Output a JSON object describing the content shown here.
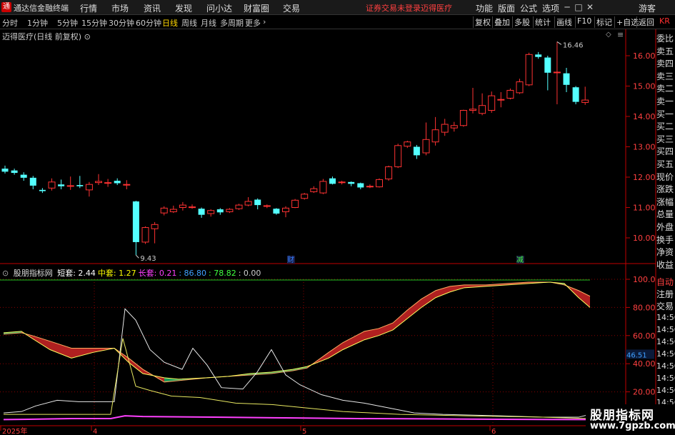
{
  "app": {
    "title": "通达信金融终端",
    "menu": [
      "行情",
      "市场",
      "资讯",
      "发现",
      "问小达",
      "财富圈",
      "交易"
    ],
    "notice": "证券交易未登录",
    "stock_name_notice": "迈得医疗",
    "right_menu": [
      "功能",
      "版面",
      "公式",
      "选项"
    ],
    "guest": "游客"
  },
  "toolbar": {
    "periods": [
      "分时",
      "1分钟",
      "5分钟",
      "15分钟",
      "30分钟",
      "60分钟",
      "日线",
      "周线",
      "月线",
      "多周期",
      "更多"
    ],
    "active_period": "日线",
    "buttons": [
      "复权",
      "叠加",
      "多股",
      "统计",
      "画线",
      "F10",
      "标记",
      "+自选",
      "返回"
    ]
  },
  "chart": {
    "header": "迈得医疗(日线 前复权)",
    "price_ticks": [
      "16.00",
      "15.00",
      "14.00",
      "13.00",
      "12.00",
      "11.00",
      "10.00"
    ],
    "annotations": {
      "high": "16.46",
      "low": "9.43",
      "mark1": "财",
      "mark2": "减"
    },
    "date_labels": [
      "2025年",
      "4",
      "5",
      "6"
    ],
    "candles": [
      {
        "o": 12.28,
        "c": 12.18,
        "h": 12.38,
        "l": 12.12
      },
      {
        "o": 12.22,
        "c": 12.14,
        "h": 12.28,
        "l": 12.08
      },
      {
        "o": 12.08,
        "c": 11.98,
        "h": 12.16,
        "l": 11.88
      },
      {
        "o": 11.98,
        "c": 11.72,
        "h": 12.04,
        "l": 11.6
      },
      {
        "o": 11.58,
        "c": 11.54,
        "h": 11.64,
        "l": 11.48
      },
      {
        "o": 11.64,
        "c": 11.84,
        "h": 11.96,
        "l": 11.56
      },
      {
        "o": 11.76,
        "c": 11.7,
        "h": 11.92,
        "l": 11.6
      },
      {
        "o": 11.72,
        "c": 11.72,
        "h": 12.02,
        "l": 11.58
      },
      {
        "o": 11.74,
        "c": 11.7,
        "h": 12.04,
        "l": 11.64
      },
      {
        "o": 11.58,
        "c": 11.76,
        "h": 11.84,
        "l": 11.36
      },
      {
        "o": 11.82,
        "c": 11.86,
        "h": 12.1,
        "l": 11.74
      },
      {
        "o": 11.8,
        "c": 11.82,
        "h": 11.94,
        "l": 11.68
      },
      {
        "o": 11.88,
        "c": 11.8,
        "h": 11.96,
        "l": 11.74
      },
      {
        "o": 11.74,
        "c": 11.76,
        "h": 11.9,
        "l": 11.6
      },
      {
        "o": 11.2,
        "c": 9.86,
        "h": 11.22,
        "l": 9.43
      },
      {
        "o": 9.86,
        "c": 10.34,
        "h": 10.38,
        "l": 9.8
      },
      {
        "o": 10.3,
        "c": 10.44,
        "h": 10.52,
        "l": 9.82
      },
      {
        "o": 10.82,
        "c": 10.98,
        "h": 11.04,
        "l": 10.74
      },
      {
        "o": 10.86,
        "c": 10.94,
        "h": 11.06,
        "l": 10.82
      },
      {
        "o": 11.0,
        "c": 11.08,
        "h": 11.18,
        "l": 10.9
      },
      {
        "o": 11.02,
        "c": 11.02,
        "h": 11.1,
        "l": 10.96
      },
      {
        "o": 10.96,
        "c": 10.76,
        "h": 11.0,
        "l": 10.66
      },
      {
        "o": 10.8,
        "c": 10.9,
        "h": 10.94,
        "l": 10.7
      },
      {
        "o": 10.94,
        "c": 10.84,
        "h": 10.98,
        "l": 10.76
      },
      {
        "o": 10.86,
        "c": 10.94,
        "h": 10.98,
        "l": 10.82
      },
      {
        "o": 10.96,
        "c": 11.08,
        "h": 11.12,
        "l": 10.92
      },
      {
        "o": 11.08,
        "c": 11.2,
        "h": 11.34,
        "l": 11.04
      },
      {
        "o": 11.26,
        "c": 11.08,
        "h": 11.3,
        "l": 10.94
      },
      {
        "o": 11.04,
        "c": 11.06,
        "h": 11.1,
        "l": 10.98
      },
      {
        "o": 10.96,
        "c": 10.8,
        "h": 10.98,
        "l": 10.76
      },
      {
        "o": 10.86,
        "c": 10.98,
        "h": 11.04,
        "l": 10.68
      },
      {
        "o": 11.0,
        "c": 11.24,
        "h": 11.28,
        "l": 10.98
      },
      {
        "o": 11.3,
        "c": 11.44,
        "h": 11.48,
        "l": 11.26
      },
      {
        "o": 11.52,
        "c": 11.62,
        "h": 11.7,
        "l": 11.48
      },
      {
        "o": 11.48,
        "c": 11.86,
        "h": 11.94,
        "l": 11.44
      },
      {
        "o": 11.96,
        "c": 11.78,
        "h": 12.02,
        "l": 11.76
      },
      {
        "o": 11.84,
        "c": 11.84,
        "h": 11.88,
        "l": 11.76
      },
      {
        "o": 11.84,
        "c": 11.78,
        "h": 11.86,
        "l": 11.7
      },
      {
        "o": 11.8,
        "c": 11.66,
        "h": 11.82,
        "l": 11.6
      },
      {
        "o": 11.7,
        "c": 11.7,
        "h": 11.76,
        "l": 11.64
      },
      {
        "o": 11.68,
        "c": 11.92,
        "h": 11.96,
        "l": 11.66
      },
      {
        "o": 11.94,
        "c": 12.34,
        "h": 12.38,
        "l": 11.88
      },
      {
        "o": 12.34,
        "c": 13.04,
        "h": 13.1,
        "l": 12.3
      },
      {
        "o": 13.02,
        "c": 13.16,
        "h": 13.2,
        "l": 12.96
      },
      {
        "o": 13.0,
        "c": 12.72,
        "h": 13.06,
        "l": 12.6
      },
      {
        "o": 12.8,
        "c": 13.24,
        "h": 13.8,
        "l": 12.72
      },
      {
        "o": 13.16,
        "c": 13.56,
        "h": 13.98,
        "l": 13.04
      },
      {
        "o": 13.48,
        "c": 13.74,
        "h": 13.92,
        "l": 13.36
      },
      {
        "o": 13.62,
        "c": 13.7,
        "h": 13.82,
        "l": 13.5
      },
      {
        "o": 13.7,
        "c": 14.2,
        "h": 14.22,
        "l": 13.66
      },
      {
        "o": 14.2,
        "c": 14.24,
        "h": 14.94,
        "l": 14.1
      },
      {
        "o": 14.1,
        "c": 14.36,
        "h": 14.76,
        "l": 14.04
      },
      {
        "o": 14.2,
        "c": 14.68,
        "h": 14.82,
        "l": 14.12
      },
      {
        "o": 14.56,
        "c": 14.56,
        "h": 14.8,
        "l": 14.3
      },
      {
        "o": 14.6,
        "c": 14.86,
        "h": 14.92,
        "l": 14.56
      },
      {
        "o": 14.78,
        "c": 15.14,
        "h": 15.24,
        "l": 14.74
      },
      {
        "o": 15.04,
        "c": 16.04,
        "h": 16.1,
        "l": 15.0
      },
      {
        "o": 16.04,
        "c": 15.96,
        "h": 16.12,
        "l": 15.9
      },
      {
        "o": 15.94,
        "c": 15.44,
        "h": 16.0,
        "l": 14.86
      },
      {
        "o": 15.46,
        "c": 15.46,
        "h": 16.46,
        "l": 14.4
      },
      {
        "o": 15.42,
        "c": 15.04,
        "h": 15.6,
        "l": 14.8
      },
      {
        "o": 14.96,
        "c": 14.48,
        "h": 15.0,
        "l": 14.4
      },
      {
        "o": 14.46,
        "c": 14.54,
        "h": 14.98,
        "l": 14.38
      }
    ]
  },
  "right_panel": {
    "quote_labels": [
      "委比",
      "卖五",
      "卖四",
      "卖三",
      "卖二",
      "卖一",
      "买一",
      "买二",
      "买三",
      "买四",
      "买五",
      "现价",
      "涨跌",
      "涨幅",
      "总量",
      "外盘",
      "换手",
      "净资",
      "收益"
    ],
    "bottom_labels": [
      "自动",
      "注册",
      "交易"
    ],
    "time_labels": [
      "14:56",
      "14:56",
      "14:56",
      "14:56",
      "14:56",
      "14:56",
      "14:56",
      "14:56",
      "14:56"
    ]
  },
  "indicator": {
    "name": "股朋指标网",
    "items": [
      {
        "label": "短套: 2.44",
        "color": "#ffffff"
      },
      {
        "label": "中套: 1.27",
        "color": "#ffff00"
      },
      {
        "label": "长套: 0.21",
        "color": "#ff40ff"
      },
      {
        "label": ": 86.80",
        "color": "#40a0ff"
      },
      {
        "label": ": 78.82",
        "color": "#40ff40"
      },
      {
        "label": ": 0.00",
        "color": "#cccccc"
      }
    ],
    "ticks": [
      "100.0",
      "80.00",
      "60.00",
      "40.00",
      "20.00"
    ],
    "current_value": "46.51"
  },
  "watermark": {
    "top": "股朋指标网",
    "bottom": "www.7gpzb.com"
  },
  "colors": {
    "up": "#ff3232",
    "down": "#54ffff",
    "grid": "#8b0000",
    "axis": "#c00000"
  }
}
